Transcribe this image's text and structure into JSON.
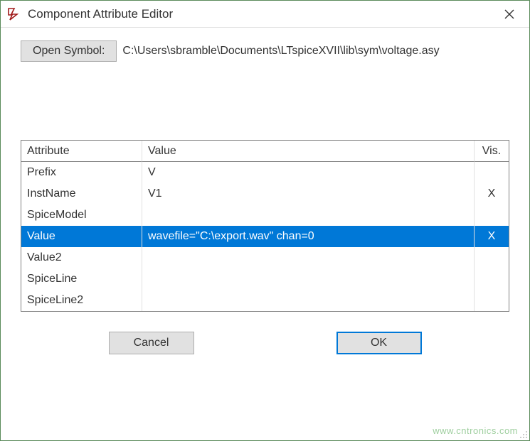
{
  "window": {
    "title": "Component Attribute Editor"
  },
  "symbol": {
    "button_label": "Open Symbol:",
    "path": "C:\\Users\\sbramble\\Documents\\LTspiceXVII\\lib\\sym\\voltage.asy"
  },
  "table": {
    "headers": {
      "attribute": "Attribute",
      "value": "Value",
      "vis": "Vis."
    },
    "rows": [
      {
        "attribute": "Prefix",
        "value": "V",
        "vis": "",
        "selected": false
      },
      {
        "attribute": "InstName",
        "value": "V1",
        "vis": "X",
        "selected": false
      },
      {
        "attribute": "SpiceModel",
        "value": "",
        "vis": "",
        "selected": false
      },
      {
        "attribute": "Value",
        "value": "wavefile=\"C:\\export.wav\" chan=0",
        "vis": "X",
        "selected": true
      },
      {
        "attribute": "Value2",
        "value": "",
        "vis": "",
        "selected": false
      },
      {
        "attribute": "SpiceLine",
        "value": "",
        "vis": "",
        "selected": false
      },
      {
        "attribute": "SpiceLine2",
        "value": "",
        "vis": "",
        "selected": false
      }
    ]
  },
  "buttons": {
    "cancel": "Cancel",
    "ok": "OK"
  },
  "watermark": "www.cntronics.com"
}
